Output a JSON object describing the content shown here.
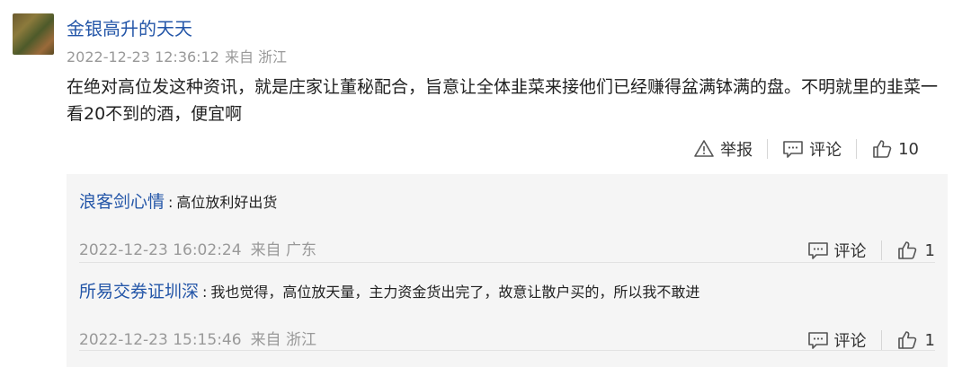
{
  "post": {
    "username": "金银高升的天天",
    "timestamp": "2022-12-23 12:36:12",
    "source": "来自 浙江",
    "content": "在绝对高位发这种资讯，就是庄家让董秘配合，旨意让全体韭菜来接他们已经赚得盆满钵满的盘。不明就里的韭菜一看20不到的酒，便宜啊",
    "report_label": "举报",
    "comment_label": "评论",
    "like_count": "10"
  },
  "replies": [
    {
      "username": "浪客剑心情",
      "colon": ":",
      "text": "高位放利好出货",
      "timestamp": "2022-12-23 16:02:24",
      "source": "来自 广东",
      "comment_label": "评论",
      "like_count": "1"
    },
    {
      "username": "所易交券证圳深",
      "colon": ":",
      "text": "我也觉得，高位放天量，主力资金货出完了，故意让散户买的，所以我不敢进",
      "timestamp": "2022-12-23 15:15:46",
      "source": "来自 浙江",
      "comment_label": "评论",
      "like_count": "1"
    }
  ],
  "icons": [
    "warning-icon",
    "comment-icon",
    "thumbs-up-icon"
  ]
}
